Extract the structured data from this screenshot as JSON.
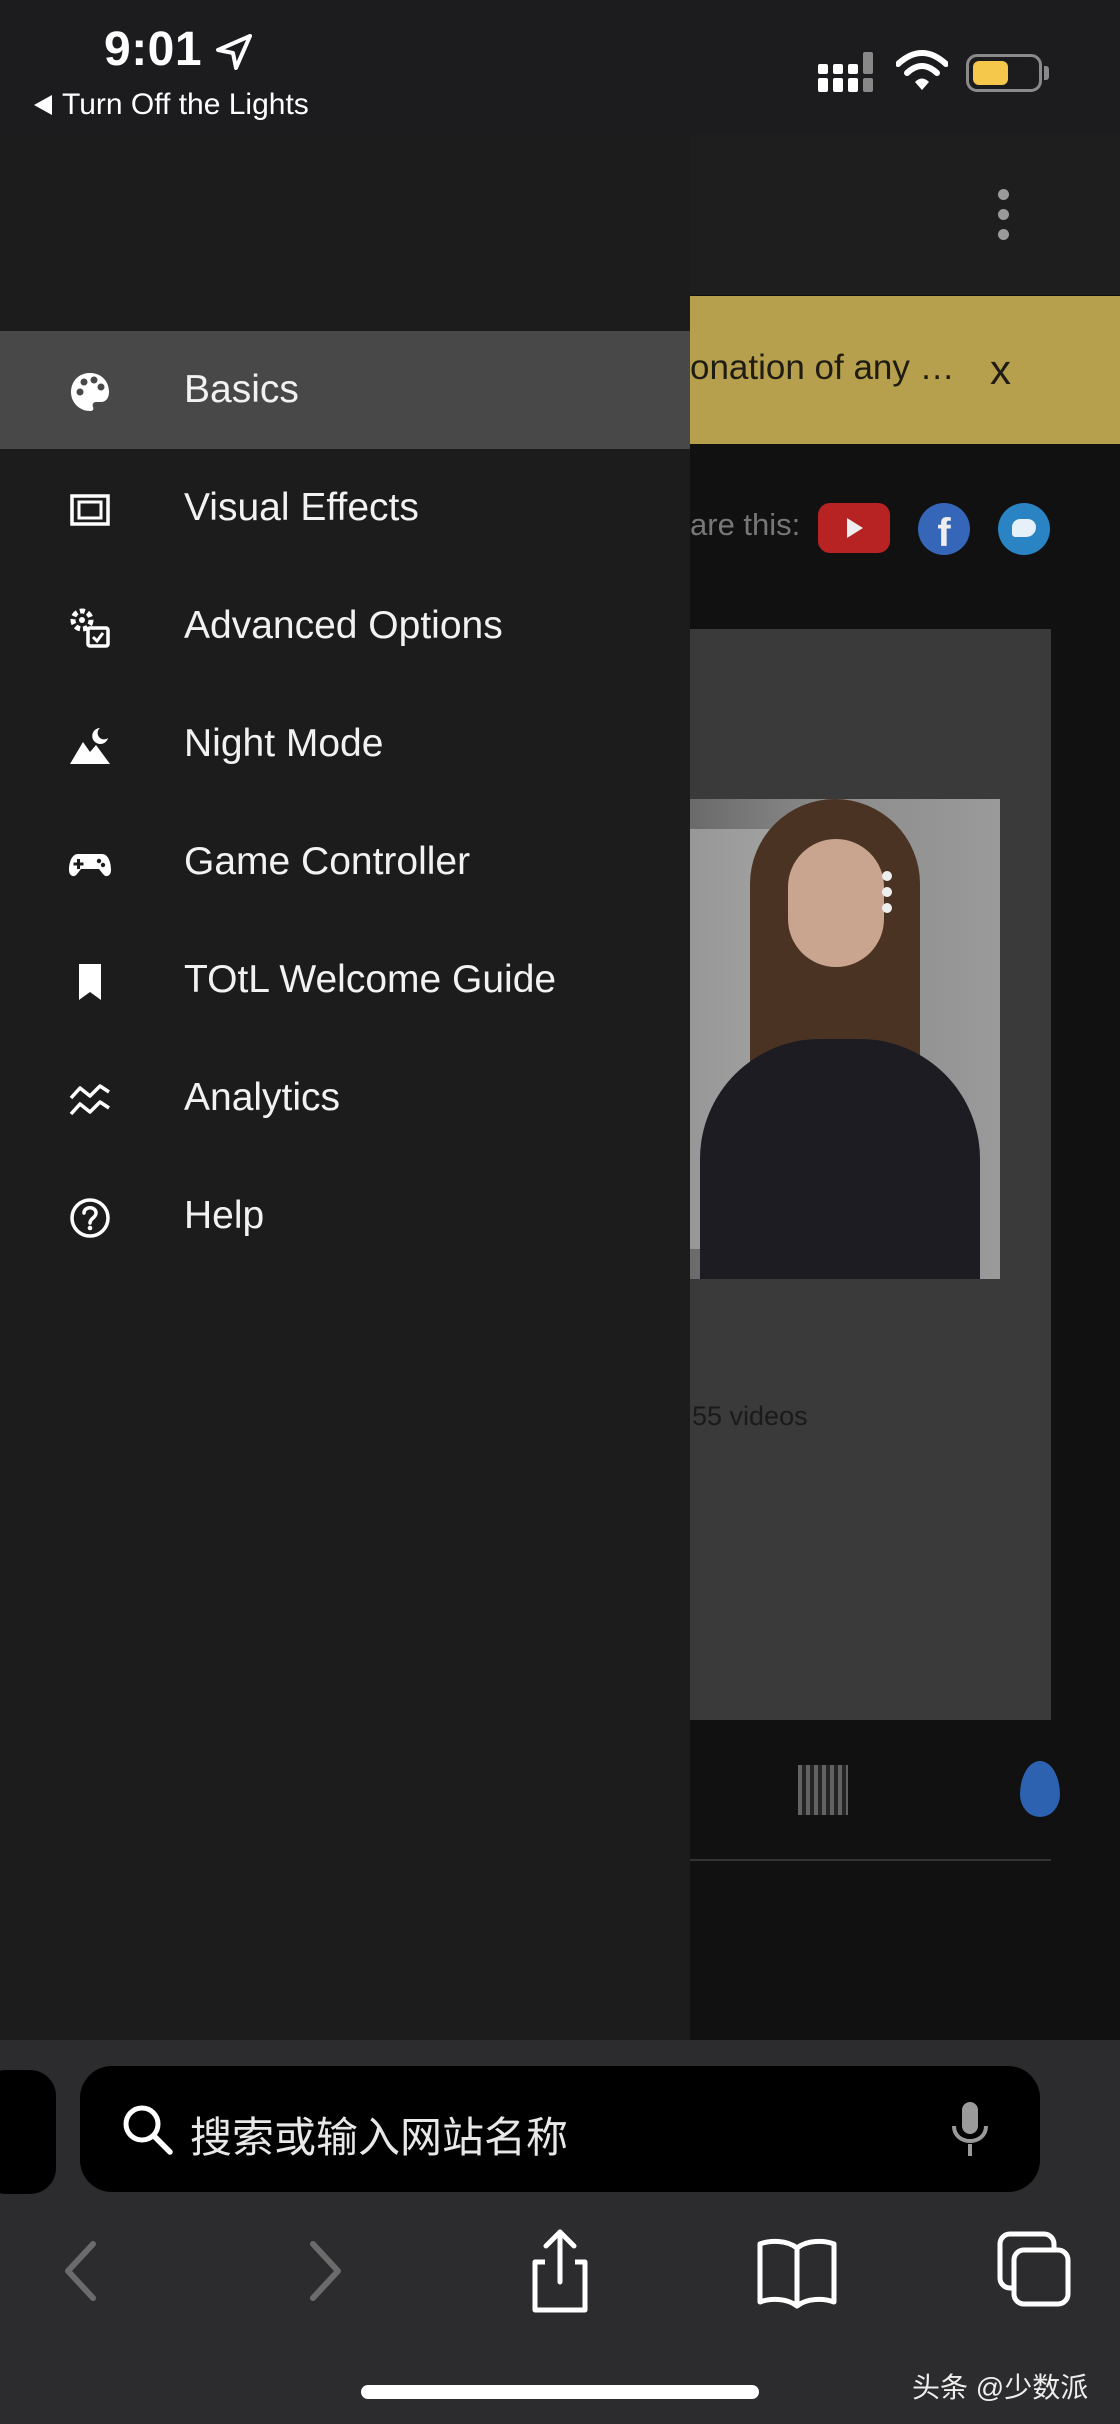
{
  "status_bar": {
    "time": "9:01",
    "back_app_label": "Turn Off the Lights",
    "battery_color": "#f5c84c"
  },
  "background_page": {
    "banner_text": "onation of any …",
    "banner_close": "x",
    "share_label": "are this:",
    "share_icons": [
      "youtube-icon",
      "facebook-icon",
      "twitter-icon"
    ],
    "video_count": "55 videos",
    "banner_color": "#b7a04d"
  },
  "drawer": {
    "active_index": 0,
    "items": [
      {
        "label": "Basics",
        "icon": "palette-icon"
      },
      {
        "label": "Visual Effects",
        "icon": "frame-icon"
      },
      {
        "label": "Advanced Options",
        "icon": "gear-settings-icon"
      },
      {
        "label": "Night Mode",
        "icon": "mountain-moon-icon"
      },
      {
        "label": "Game Controller",
        "icon": "gamepad-icon"
      },
      {
        "label": "TOtL Welcome Guide",
        "icon": "bookmark-icon"
      },
      {
        "label": "Analytics",
        "icon": "analytics-chart-icon"
      },
      {
        "label": "Help",
        "icon": "help-circle-icon"
      }
    ]
  },
  "safari": {
    "url_placeholder": "搜索或输入网站名称",
    "toolbar": [
      "back-icon",
      "forward-icon",
      "share-icon",
      "bookmarks-icon",
      "tabs-icon"
    ]
  },
  "watermark": "头条 @少数派"
}
